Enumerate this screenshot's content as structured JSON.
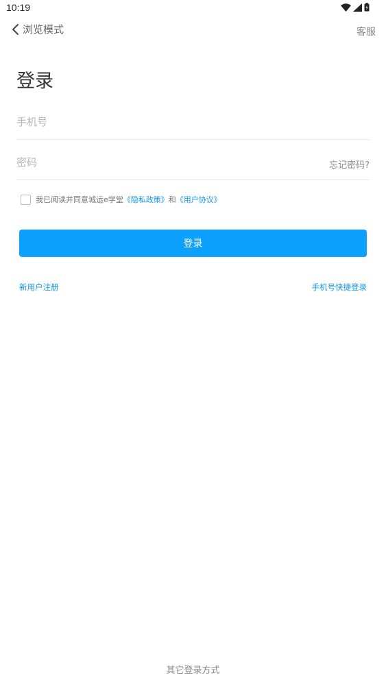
{
  "status_bar": {
    "time": "10:19"
  },
  "nav": {
    "back_label": "浏览模式",
    "service_label": "客服"
  },
  "login": {
    "title": "登录",
    "phone_placeholder": "手机号",
    "password_placeholder": "密码",
    "forgot_password": "忘记密码?",
    "agreement_prefix": "我已阅读并同意城运e学堂",
    "privacy_policy": "《隐私政策》",
    "agreement_and": "和",
    "user_agreement": "《用户协议》",
    "login_button": "登录",
    "register": "新用户注册",
    "quick_login": "手机号快捷登录",
    "other_methods": "其它登录方式"
  },
  "colors": {
    "accent": "#0ca0ff",
    "link": "#1396e8"
  }
}
